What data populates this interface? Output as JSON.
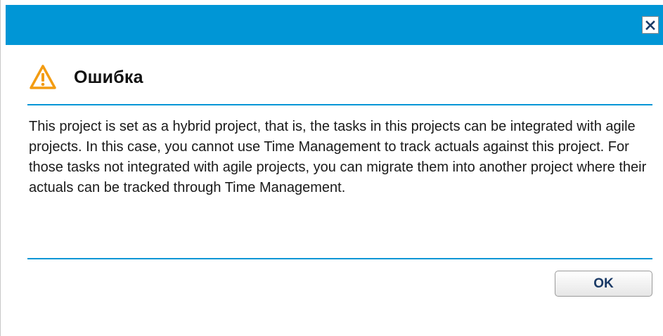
{
  "dialog": {
    "title": "Ошибка",
    "message": "This project is set as a hybrid project, that is, the tasks in this projects can be integrated with agile projects. In this case, you cannot use Time Management to track actuals against this project. For those tasks not integrated with agile projects, you can migrate them into another project where their actuals can be tracked through Time Management.",
    "ok_label": "OK",
    "close_glyph": "×",
    "icons": {
      "warning": "warning-icon",
      "close": "close-icon"
    }
  },
  "colors": {
    "accent": "#0096d6",
    "warning": "#f39c12",
    "button_text": "#1a3a66"
  }
}
